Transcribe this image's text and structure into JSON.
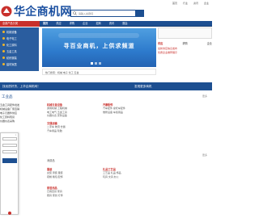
{
  "header": {
    "top_links": [
      "首页",
      "行业",
      "资讯",
      "企业"
    ],
    "logo_text": "华企商机网",
    "search_placeholder": "请输入关键词"
  },
  "nav": {
    "category_label": "全部产品分类",
    "links": [
      "首页",
      "供应",
      "求购",
      "企业",
      "招商",
      "资讯",
      "展会"
    ]
  },
  "sidebar": {
    "items": [
      "机械设备",
      "电子电工",
      "化工原料",
      "五金工具",
      "纺织服装",
      "建材家居"
    ]
  },
  "banner": {
    "headline": "寻百业商机，上供求频道",
    "subline": "热门搜索：机械 电子 化工 五金"
  },
  "right_panel": {
    "tabs": [
      "供应",
      "求购",
      "企业"
    ],
    "list": [
      "最新供应信息发布",
      "优质企业推荐展示"
    ]
  },
  "band": {
    "left_text": "找优质好货，上华企商机网！",
    "right_text": "发现更多商机"
  },
  "sections": {
    "left_title": "工业品",
    "left_list": [
      "五金工具配件批发",
      "机械设备厂家直销",
      "电子元器件供应",
      "化工原料现货",
      "仪器仪表采购"
    ],
    "col1": {
      "head": "机械五金设备",
      "text": [
        "通用机械 工程机械",
        "电工电气 五金工具",
        "仪器仪表 安防设备"
      ]
    },
    "col2": {
      "head": "汽摩配件",
      "text": [
        "汽车配件 摩托车配件",
        "维修设备 车载用品"
      ]
    },
    "col3": {
      "head": "交通运输",
      "text": [
        "二手车 物流 仓储",
        "汽车用品 轮胎"
      ]
    },
    "mid_title": "消费品",
    "col4": {
      "head": "服装",
      "text": [
        "女装 男装 童装",
        "鞋帽 箱包 配饰"
      ]
    },
    "col5": {
      "head": "礼品工艺品",
      "text": [
        "工艺品 礼品 饰品",
        "玩具 文具 办公"
      ]
    },
    "col6": {
      "head": "家居用品",
      "text": [
        "日用百货 家具",
        "厨具 家纺 灯饰"
      ]
    },
    "more_label": "更多"
  }
}
